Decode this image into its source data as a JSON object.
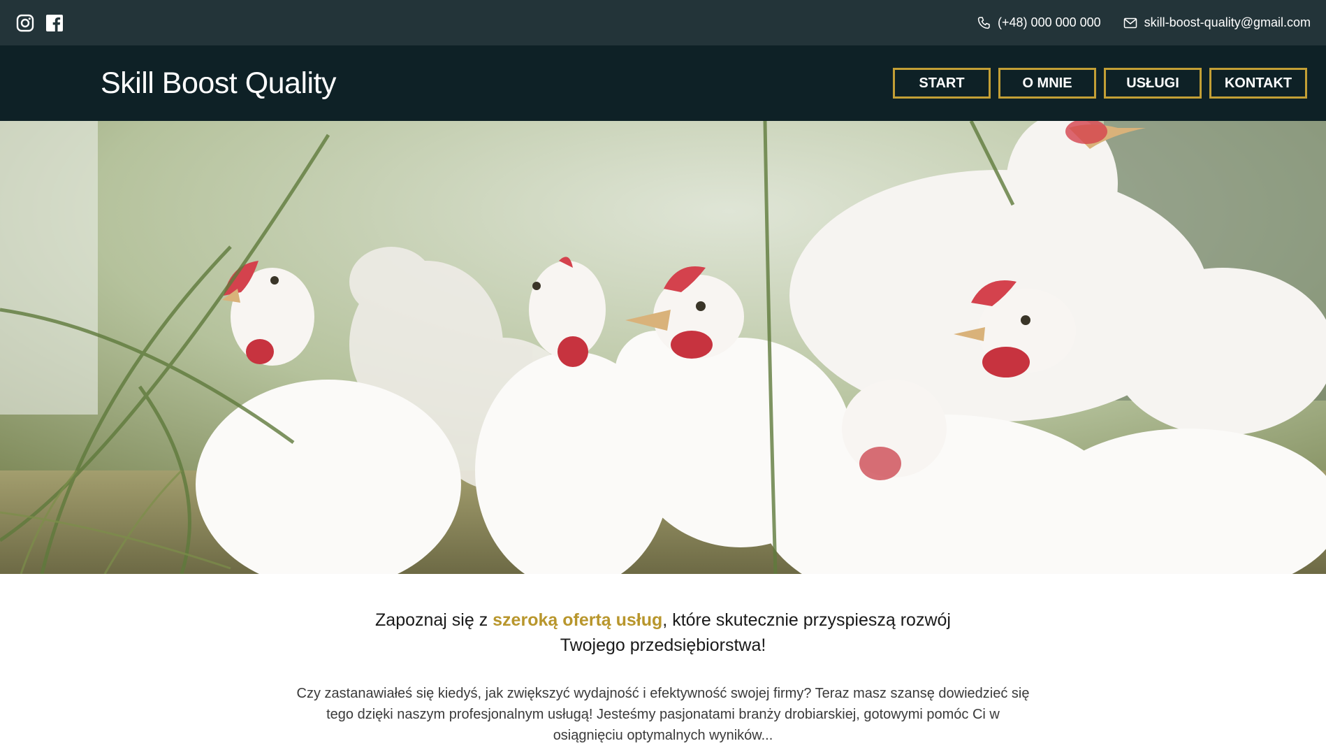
{
  "topbar": {
    "socials": [
      {
        "icon": "instagram-icon"
      },
      {
        "icon": "facebook-icon"
      }
    ],
    "phone": "(+48) 000 000 000",
    "email": "skill-boost-quality@gmail.com"
  },
  "header": {
    "logo": "Skill Boost Quality",
    "nav": [
      "START",
      "O MNIE",
      "USŁUGI",
      "KONTAKT"
    ]
  },
  "intro": {
    "headline_before": "Zapoznaj się z ",
    "headline_highlight": "szeroką ofertą usług",
    "headline_after": ", które skutecznie przyspieszą rozwój Twojego przedsiębiorstwa!",
    "paragraph": "Czy zastanawiałeś się kiedyś, jak zwiększyć wydajność i efektywność swojej firmy? Teraz masz szansę dowiedzieć się tego dzięki naszym profesjonalnym usługą! Jesteśmy pasjonatami branży drobiarskiej, gotowymi pomóc Ci w osiągnięciu optymalnych wyników..."
  },
  "colors": {
    "topbar_bg": "#233439",
    "header_bg": "#0e2126",
    "accent": "#c39f35"
  }
}
